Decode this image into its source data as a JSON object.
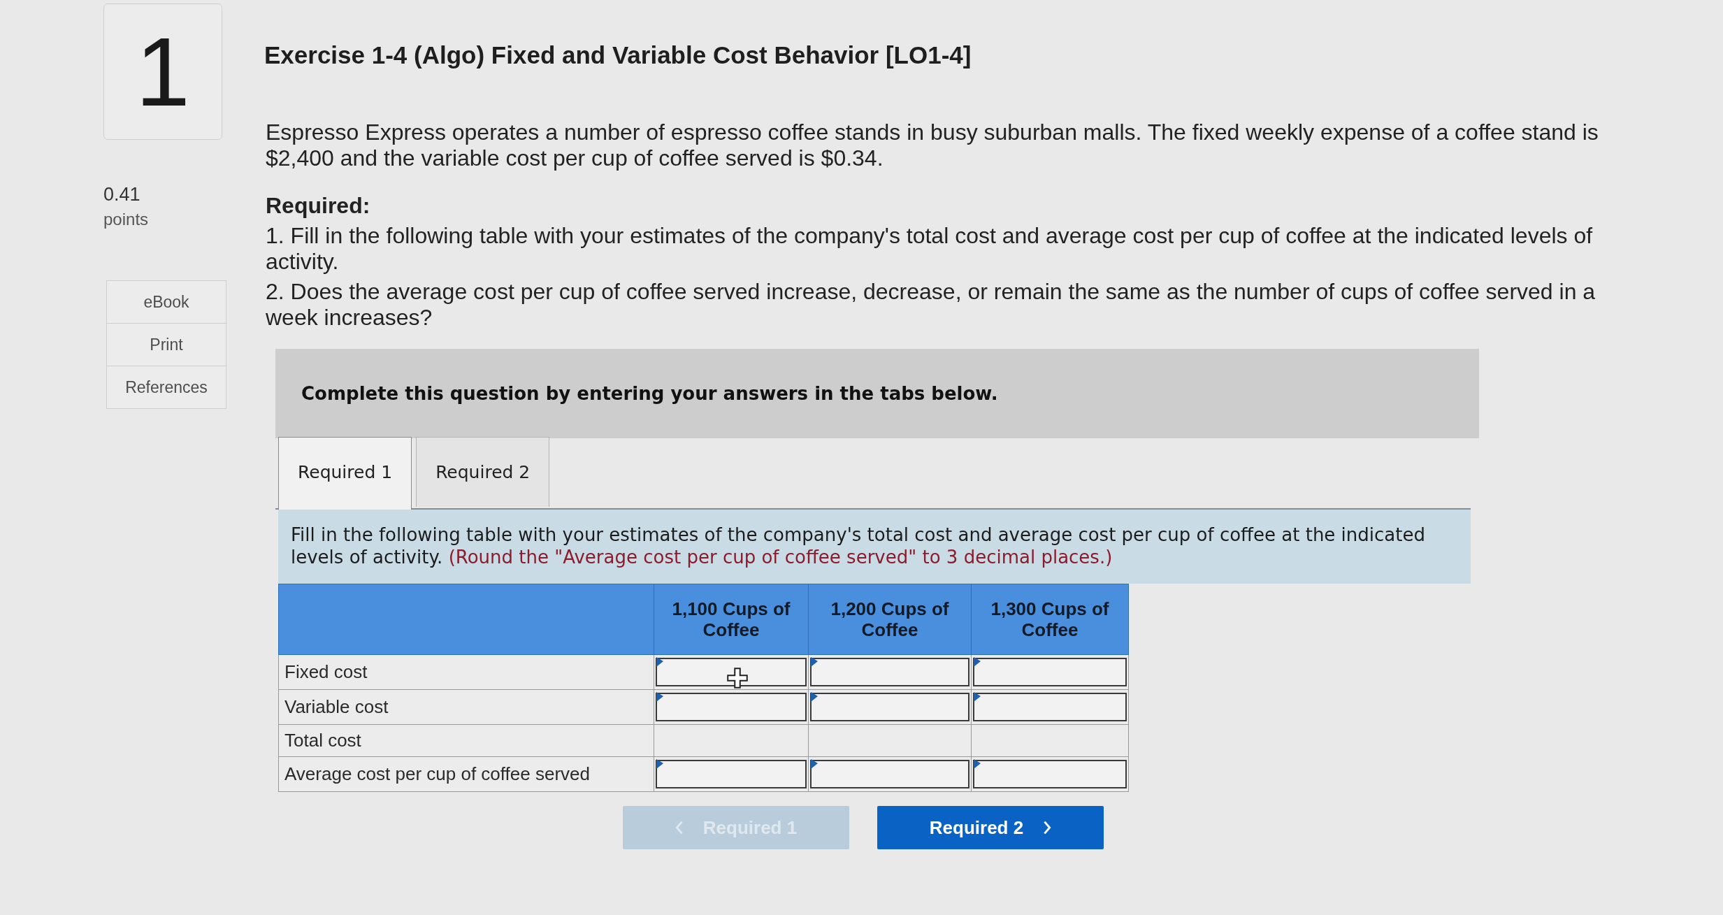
{
  "question": {
    "number": "1",
    "points": "0.41",
    "points_label": "points"
  },
  "side_links": [
    {
      "label": "eBook"
    },
    {
      "label": "Print"
    },
    {
      "label": "References"
    }
  ],
  "title": "Exercise 1-4 (Algo) Fixed and Variable Cost Behavior [LO1-4]",
  "intro": "Espresso Express operates a number of espresso coffee stands in busy suburban malls. The fixed weekly expense of a coffee stand is $2,400 and the variable cost per cup of coffee served is $0.34.",
  "required": {
    "heading": "Required:",
    "items": [
      "1. Fill in the following table with your estimates of the company's total cost and average cost per cup of coffee at the indicated levels of activity.",
      "2. Does the average cost per cup of coffee served increase, decrease, or remain the same as the number of cups of coffee served in a week increases?"
    ]
  },
  "banner": "Complete this question by entering your answers in the tabs below.",
  "tabs": [
    {
      "label": "Required 1",
      "selected": true
    },
    {
      "label": "Required 2",
      "selected": false
    }
  ],
  "instructions": {
    "text": "Fill in the following table with your estimates of the company's total cost and average cost per cup of coffee at the indicated levels of activity.",
    "note": "(Round the \"Average cost per cup of coffee served\" to 3 decimal places.)"
  },
  "table": {
    "columns": [
      "1,100 Cups of Coffee",
      "1,200 Cups of Coffee",
      "1,300 Cups of Coffee"
    ],
    "rows": [
      {
        "label": "Fixed cost",
        "kind": "input"
      },
      {
        "label": "Variable cost",
        "kind": "input"
      },
      {
        "label": "Total cost",
        "kind": "computed"
      },
      {
        "label": "Average cost per cup of coffee served",
        "kind": "input"
      }
    ]
  },
  "nav": [
    {
      "label": "Required 1",
      "kind": "prev",
      "disabled": true
    },
    {
      "label": "Required 2",
      "kind": "next",
      "disabled": false
    }
  ]
}
